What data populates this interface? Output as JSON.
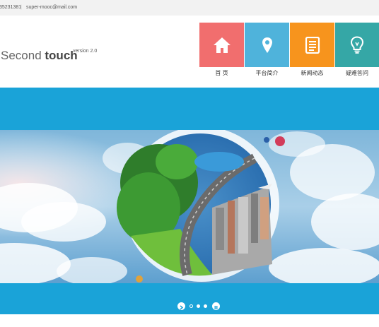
{
  "topbar": {
    "phone": "35231381",
    "separator": "|",
    "email": "super-mooc@mail.com"
  },
  "logo": {
    "light": "Second ",
    "bold": "touch",
    "version": "version 2.0"
  },
  "nav": {
    "items": [
      {
        "label": "首 页",
        "icon": "home-icon",
        "color": "#f16e6e"
      },
      {
        "label": "平台简介",
        "icon": "location-pin-icon",
        "color": "#4fb3db"
      },
      {
        "label": "新闻动态",
        "icon": "document-icon",
        "color": "#f7941d"
      },
      {
        "label": "疑难答问",
        "icon": "lightbulb-icon",
        "color": "#35a7a6"
      }
    ]
  },
  "banner": {
    "image": "planet-city-globe-illustration",
    "background_color": "#1aa3d8",
    "slides_total": 3,
    "active_slide": 1
  }
}
